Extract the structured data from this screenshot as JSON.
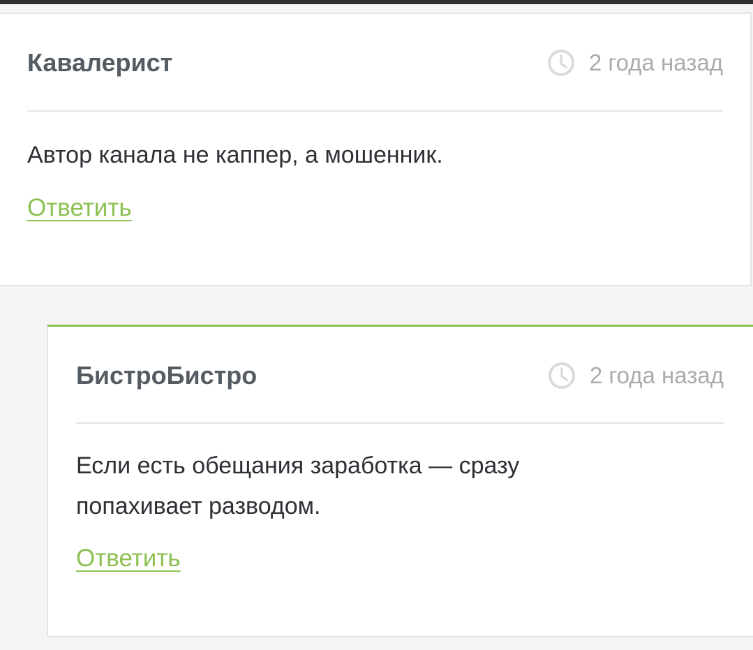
{
  "comments": [
    {
      "author": "Кавалерист",
      "time": "2 года назад",
      "text": "Автор канала не каппер, а мошенник.",
      "reply_label": "Ответить"
    },
    {
      "author": "БистроБистро",
      "time": "2 года назад",
      "text": "Если есть обещания заработка — сразу попахивает разводом.",
      "reply_label": "Ответить"
    }
  ],
  "icons": {
    "time": "clock-icon"
  },
  "colors": {
    "accent": "#8cc152",
    "author": "#545b62",
    "text": "#2d3035",
    "muted": "#a9abad",
    "page_bg": "#f4f4f4"
  }
}
